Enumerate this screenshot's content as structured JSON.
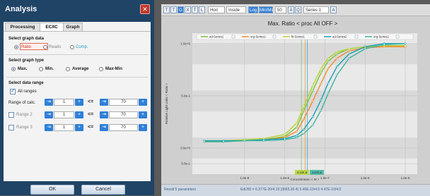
{
  "dialog": {
    "title": "Analysis",
    "tabs": [
      {
        "label": "Processing"
      },
      {
        "label": "EC/IC"
      },
      {
        "label": "Graph"
      }
    ],
    "graph_data": {
      "title": "Select graph data",
      "options": [
        {
          "label": "Ratio"
        },
        {
          "label": "Reads"
        },
        {
          "label": "Comp."
        }
      ]
    },
    "graph_type": {
      "title": "Select graph type",
      "options": [
        {
          "label": "Max."
        },
        {
          "label": "Min."
        },
        {
          "label": "Average"
        },
        {
          "label": "Max-Min"
        }
      ]
    },
    "data_range": {
      "title": "Select data range",
      "all_ranges": "All ranges",
      "range_of_calc": "Range of calc.",
      "rows": [
        {
          "label": "",
          "from": "1",
          "to": "70"
        },
        {
          "label": "Range 2",
          "from": "1",
          "to": "70"
        },
        {
          "label": "Range 3",
          "from": "1",
          "to": "70"
        }
      ]
    },
    "ok": "OK",
    "cancel": "Cancel"
  },
  "toolbar": {
    "items": [
      "T",
      "T",
      "G",
      "X",
      "T",
      "L",
      "Hori",
      "Inside",
      "Log",
      "Min/Ms",
      "50",
      "A",
      "Q",
      "Series 1",
      "A"
    ]
  },
  "chart": {
    "colors": {
      "ratio": "#c0392b",
      "comp": "#18a0b8",
      "series_blue": "#3a9ad9",
      "teal": "#3bb3a0",
      "green": "#7bbf3a",
      "lime": "#b5d334",
      "orange": "#f08a30"
    },
    "status_left": "Result 5 parameters",
    "status_right": "EdU50 = 6.377E-20/4.19 (3665.20.4) 5.40E-10/4.5 4.47E-10/4.0"
  },
  "chart_data": {
    "type": "line",
    "title": "Max. Ratio < proc All OFF >",
    "xlabel": "Concentration < M >",
    "ylabel": "Relative Light Units < Ratio >",
    "x_scale": "log",
    "x_ticks": [
      "1.0e-9",
      "1.0e-8",
      "1.0e-7",
      "1.0e-6",
      "1.0e-5"
    ],
    "y_ticks": [
      "1.0e+0",
      "5.0e-1",
      "0.0e+0",
      "5.0e-1"
    ],
    "legend": [
      {
        "name": "ad-Series1",
        "color": "#7bbf3a"
      },
      {
        "name": "org-Series1",
        "color": "#f08a30"
      },
      {
        "name": "fit-Series1",
        "color": "#b5d334"
      },
      {
        "name": "ad-Series2",
        "color": "#18a0b8"
      },
      {
        "name": "org-Series2",
        "color": "#3bb3a0"
      }
    ],
    "ec50_labels": [
      "3.22E-8",
      "3.67E-8"
    ],
    "series": [
      {
        "name": "ad-Series1",
        "color": "#7bbf3a",
        "x": [
          1e-10,
          3e-10,
          1e-09,
          3e-09,
          1e-08,
          2e-08,
          3e-08,
          5e-08,
          8e-08,
          1.2e-07,
          2e-07,
          4e-07,
          1e-06,
          3e-06,
          1e-05
        ],
        "y": [
          0.06,
          0.07,
          0.07,
          0.08,
          0.11,
          0.2,
          0.36,
          0.55,
          0.72,
          0.83,
          0.9,
          0.95,
          0.97,
          0.98,
          0.98
        ]
      },
      {
        "name": "org-Series1",
        "color": "#f08a30",
        "x": [
          1e-10,
          3e-10,
          1e-09,
          3e-09,
          1e-08,
          2e-08,
          3e-08,
          5e-08,
          8e-08,
          1.2e-07,
          2e-07,
          4e-07,
          1e-06,
          3e-06,
          1e-05
        ],
        "y": [
          0.06,
          0.06,
          0.07,
          0.08,
          0.1,
          0.16,
          0.28,
          0.45,
          0.62,
          0.76,
          0.86,
          0.93,
          0.96,
          0.97,
          0.97
        ]
      },
      {
        "name": "fit-Series1",
        "color": "#b5d334",
        "x": [
          1e-10,
          3e-10,
          1e-09,
          3e-09,
          1e-08,
          2e-08,
          3e-08,
          5e-08,
          8e-08,
          1.2e-07,
          2e-07,
          4e-07,
          1e-06,
          3e-06,
          1e-05
        ],
        "y": [
          0.07,
          0.07,
          0.08,
          0.09,
          0.13,
          0.24,
          0.4,
          0.6,
          0.76,
          0.86,
          0.92,
          0.95,
          0.97,
          0.98,
          0.98
        ]
      },
      {
        "name": "ad-Series2",
        "color": "#18a0b8",
        "x": [
          1e-10,
          3e-10,
          1e-09,
          3e-09,
          1e-08,
          2e-08,
          3e-08,
          5e-08,
          8e-08,
          1.2e-07,
          2e-07,
          4e-07,
          1e-06,
          3e-06,
          1e-05
        ],
        "y": [
          0.07,
          0.07,
          0.07,
          0.08,
          0.09,
          0.12,
          0.18,
          0.3,
          0.46,
          0.62,
          0.78,
          0.9,
          0.97,
          1.0,
          1.0
        ]
      },
      {
        "name": "org-Series2",
        "color": "#3bb3a0",
        "x": [
          1e-10,
          3e-10,
          1e-09,
          3e-09,
          1e-08,
          2e-08,
          3e-08,
          5e-08,
          8e-08,
          1.2e-07,
          2e-07,
          4e-07,
          1e-06,
          3e-06,
          1e-05
        ],
        "y": [
          0.06,
          0.06,
          0.07,
          0.07,
          0.08,
          0.1,
          0.14,
          0.22,
          0.36,
          0.52,
          0.7,
          0.86,
          0.95,
          0.99,
          1.0
        ]
      }
    ]
  }
}
